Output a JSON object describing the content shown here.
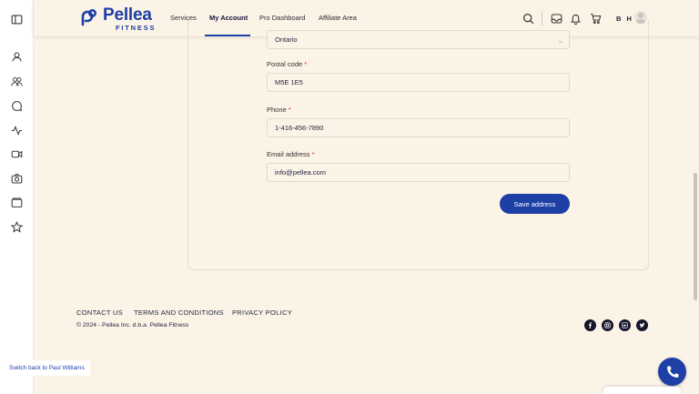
{
  "brand": {
    "name": "Pellea",
    "sub": "FITNESS",
    "color": "#1d3fa6"
  },
  "nav": {
    "services": "Services",
    "my_account": "My Account",
    "pro_dashboard": "Pro Dashboard",
    "affiliate_area": "Affiliate Area"
  },
  "user": {
    "initials": "B H"
  },
  "form": {
    "province_value": "Ontario",
    "postal_label": "Postal code",
    "postal_value": "M5E 1E5",
    "phone_label": "Phone",
    "phone_value": "1-416-456-7890",
    "email_label": "Email address",
    "email_value": "info@pellea.com",
    "required_mark": "*",
    "save_label": "Save address"
  },
  "footer": {
    "contact": "CONTACT US",
    "terms": "TERMS AND CONDITIONS",
    "privacy": "PRIVACY POLICY",
    "copyright": "© 2024 - Pellea Inc. d.b.a. Pellea Fitness"
  },
  "switch_back": "Switch back to Paul Williams",
  "icons": {
    "rail": [
      "sidebar-toggle-icon",
      "user-icon",
      "users-icon",
      "chat-icon",
      "activity-icon",
      "video-icon",
      "camera-icon",
      "folder-icon",
      "star-icon"
    ],
    "toolbar": [
      "search-icon",
      "inbox-icon",
      "bell-icon",
      "cart-icon"
    ],
    "social": [
      "facebook-icon",
      "instagram-icon",
      "linkedin-icon",
      "twitter-icon"
    ]
  },
  "colors": {
    "background": "#fbf3e6",
    "accent": "#1d3fa6",
    "required": "#d9323c"
  }
}
